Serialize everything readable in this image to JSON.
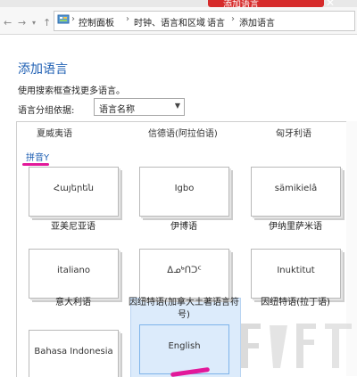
{
  "window": {
    "title": "添加语言"
  },
  "address_bar": {
    "crumbs": [
      "控制面板",
      "时钟、语言和区域",
      "语言",
      "添加语言"
    ]
  },
  "page": {
    "title": "添加语言",
    "hint": "使用搜索框查找更多语言。",
    "group_label": "语言分组依据:",
    "group_select": "语言名称"
  },
  "list": {
    "top_row": [
      "夏威夷语",
      "信德语(阿拉伯语)",
      "匈牙利语"
    ],
    "section": "拼音Y",
    "tiles": [
      {
        "name": "Հայերեն",
        "caption": "亚美尼亚语",
        "selected": false
      },
      {
        "name": "Igbo",
        "caption": "伊博语",
        "selected": false
      },
      {
        "name": "sämikielâ",
        "caption": "伊纳里萨米语",
        "selected": false
      },
      {
        "name": "italiano",
        "caption": "意大利语",
        "selected": false
      },
      {
        "name": "ᐃᓄᒃᑎᑐᑦ",
        "caption": "因纽特语(加拿大土著语言符号)",
        "selected": false
      },
      {
        "name": "Inuktitut",
        "caption": "因纽特语(拉丁语)",
        "selected": false
      },
      {
        "name": "Bahasa Indonesia",
        "caption": "",
        "selected": false
      },
      {
        "name": "English",
        "caption": "",
        "selected": true
      }
    ]
  },
  "colors": {
    "accent": "#1e5fb3",
    "marker": "#e2189a",
    "selection": "#dcebfb"
  }
}
